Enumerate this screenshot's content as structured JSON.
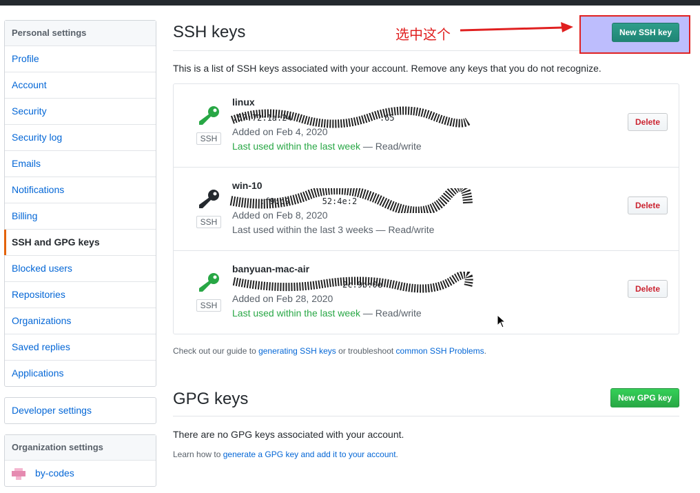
{
  "sidebar": {
    "personal_heading": "Personal settings",
    "items": [
      {
        "label": "Profile"
      },
      {
        "label": "Account"
      },
      {
        "label": "Security"
      },
      {
        "label": "Security log"
      },
      {
        "label": "Emails"
      },
      {
        "label": "Notifications"
      },
      {
        "label": "Billing"
      },
      {
        "label": "SSH and GPG keys",
        "selected": true
      },
      {
        "label": "Blocked users"
      },
      {
        "label": "Repositories"
      },
      {
        "label": "Organizations"
      },
      {
        "label": "Saved replies"
      },
      {
        "label": "Applications"
      }
    ],
    "developer_settings": "Developer settings",
    "org_heading": "Organization settings",
    "org_item": "by-codes"
  },
  "ssh": {
    "title": "SSH keys",
    "new_button": "New SSH key",
    "annotation": "选中这个",
    "description": "This is a list of SSH keys associated with your account. Remove any keys that you do not recognize.",
    "badge": "SSH",
    "delete_label": "Delete",
    "keys": [
      {
        "title": "linux",
        "fingerprint": ":57:72:1a:24",
        "fingerprint_tail": ":65",
        "added": "Added on Feb 4, 2020",
        "last_used": "Last used within the last week",
        "access": " — Read/write",
        "recent": true
      },
      {
        "title": "win-10",
        "fingerprint": ":f9:c9",
        "fingerprint_tail": "52:4e:2",
        "added": "Added on Feb 8, 2020",
        "last_used": "Last used within the last 3 weeks",
        "access": " — Read/write",
        "recent": false
      },
      {
        "title": "banyuan-mac-air",
        "fingerprint": "",
        "fingerprint_tail": "2c:9b:0e",
        "added": "Added on Feb 28, 2020",
        "last_used": "Last used within the last week",
        "access": " — Read/write",
        "recent": true
      }
    ],
    "guide_prefix": "Check out our guide to ",
    "guide_link1": "generating SSH keys",
    "guide_middle": " or troubleshoot ",
    "guide_link2": "common SSH Problems",
    "guide_suffix": "."
  },
  "gpg": {
    "title": "GPG keys",
    "new_button": "New GPG key",
    "empty": "There are no GPG keys associated with your account.",
    "learn_prefix": "Learn how to ",
    "learn_link": "generate a GPG key and add it to your account",
    "learn_suffix": "."
  },
  "colors": {
    "link": "#0366d6",
    "success": "#28a745",
    "danger": "#cb2431",
    "annotation": "#e02020"
  },
  "icons": {
    "key": "key-icon",
    "arrow": "annotation-arrow",
    "cursor": "mouse-cursor-icon",
    "org_avatar": "org-avatar"
  }
}
